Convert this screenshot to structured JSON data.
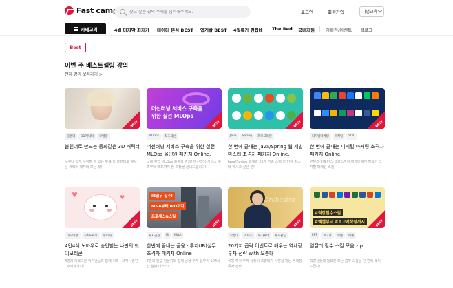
{
  "header": {
    "logo_text": "Fast campus",
    "search_placeholder": "찾고 싶은 강의 주제를 입력해주세요.",
    "login": "로그인",
    "signup": "회원가입",
    "business": "기업교육"
  },
  "nav": {
    "category_button": "카테고리",
    "items": [
      "4월 마지막 최저가",
      "데이터 분석 BEST",
      "엡개발 BEST",
      "4월특가 편집네",
      "The Red",
      "국비지원",
      "기획전/이벤트",
      "블로그"
    ]
  },
  "section": {
    "badge": "Best",
    "title": "이번 주 베스트셀링 강의",
    "view_all": "전체 강의 보러가기 >"
  },
  "thumb_ribbon": "BEST",
  "courses": [
    {
      "tags": [
        "블렌더",
        "3D캐릭터",
        "모델링"
      ],
      "title": "블렌더로 만드는 동화같은 3D 캐릭터",
      "desc": "누구나 쉽게 시작할 수 있는 무료 툴 블렌더로 배우는 캐릭터 제작의 모든 것!"
    },
    {
      "tags": [
        "MLOps",
        "최초최신"
      ],
      "title": "머신러닝 서비스 구축을 위한 실전 MLOps 올인원 패키지 Online.",
      "desc": "국내 현업 MLOps 총괄의 강의! 머신러닝 서비스 구축부터 배포까지 한 과정을 끝내드립니다!",
      "thumb_text": "머신러닝 서비스 구축을 위한 실전 MLOps"
    },
    {
      "tags": [
        "Java",
        "Spring",
        "프로그래밍"
      ],
      "title": "한 번에 끝내는 Java/Spring 웹 개발 마스터 초격차 패키지 Online.",
      "desc": "Java/Spring 웹개발 25개 기술 스택 한 번에 마스터 하시고 싶은 분!"
    },
    {
      "tags": [
        "디지털마케팅",
        "마케팅",
        "SQL"
      ],
      "title": "한 번에 끝내는 디지털 마케팅 초격차 패키지 Online.",
      "desc": "콘텐츠·퍼포먼스·그로스까지 마케터에게 필요한 디지털 마케팅 스킬"
    },
    {
      "tags": [
        "이모티콘",
        "기획&제작",
        "수익화"
      ],
      "title": "4인4색 노하우로 승인받는 나만의 첫 이모티콘",
      "desc": "4명의 이모티콘 작가님들과 함께 기획 · 제작 · 승인 · 수익화까지!"
    },
    {
      "tags": [
        "투자금융",
        "IB",
        "M&A"
      ],
      "title": "한번에 끝내는 금융 · 투자(IB)실무 초격차 패키지 Online",
      "desc": "7명의 현업 전문가와 함께 금융 투자 실무의 104시간 완벽 마스터!",
      "thumb_lines": [
        "IB업무 필수!",
        "M&A부터 IPO까지",
        "프로세스&스킬"
      ]
    },
    {
      "tags": [
        "오층대",
        "액세스",
        "투자재테",
        "투자판단"
      ],
      "title": "20가지 급락 이벤트로 배우는 역세장 투자 전략 with 오층대",
      "desc": "유명 주식 투자 유튜버 오층대가 시장을 읽는 역세장 투자 전략",
      "thumb_text": "Orchestra"
    },
    {
      "tags": [
        "PPT",
        "보고서",
        "엑셀",
        "엑셀"
      ],
      "title": "일잘러 필수 스킬 모음.zip",
      "desc": "직장생활에 필요한 모든 업무 스킬을 한 번에 모아 드립니다",
      "thumb_lines": [
        "#직장필수스킬",
        "#엑셀부터 #보고서작성까지"
      ]
    }
  ],
  "colors": {
    "brand": "#e0173c"
  }
}
